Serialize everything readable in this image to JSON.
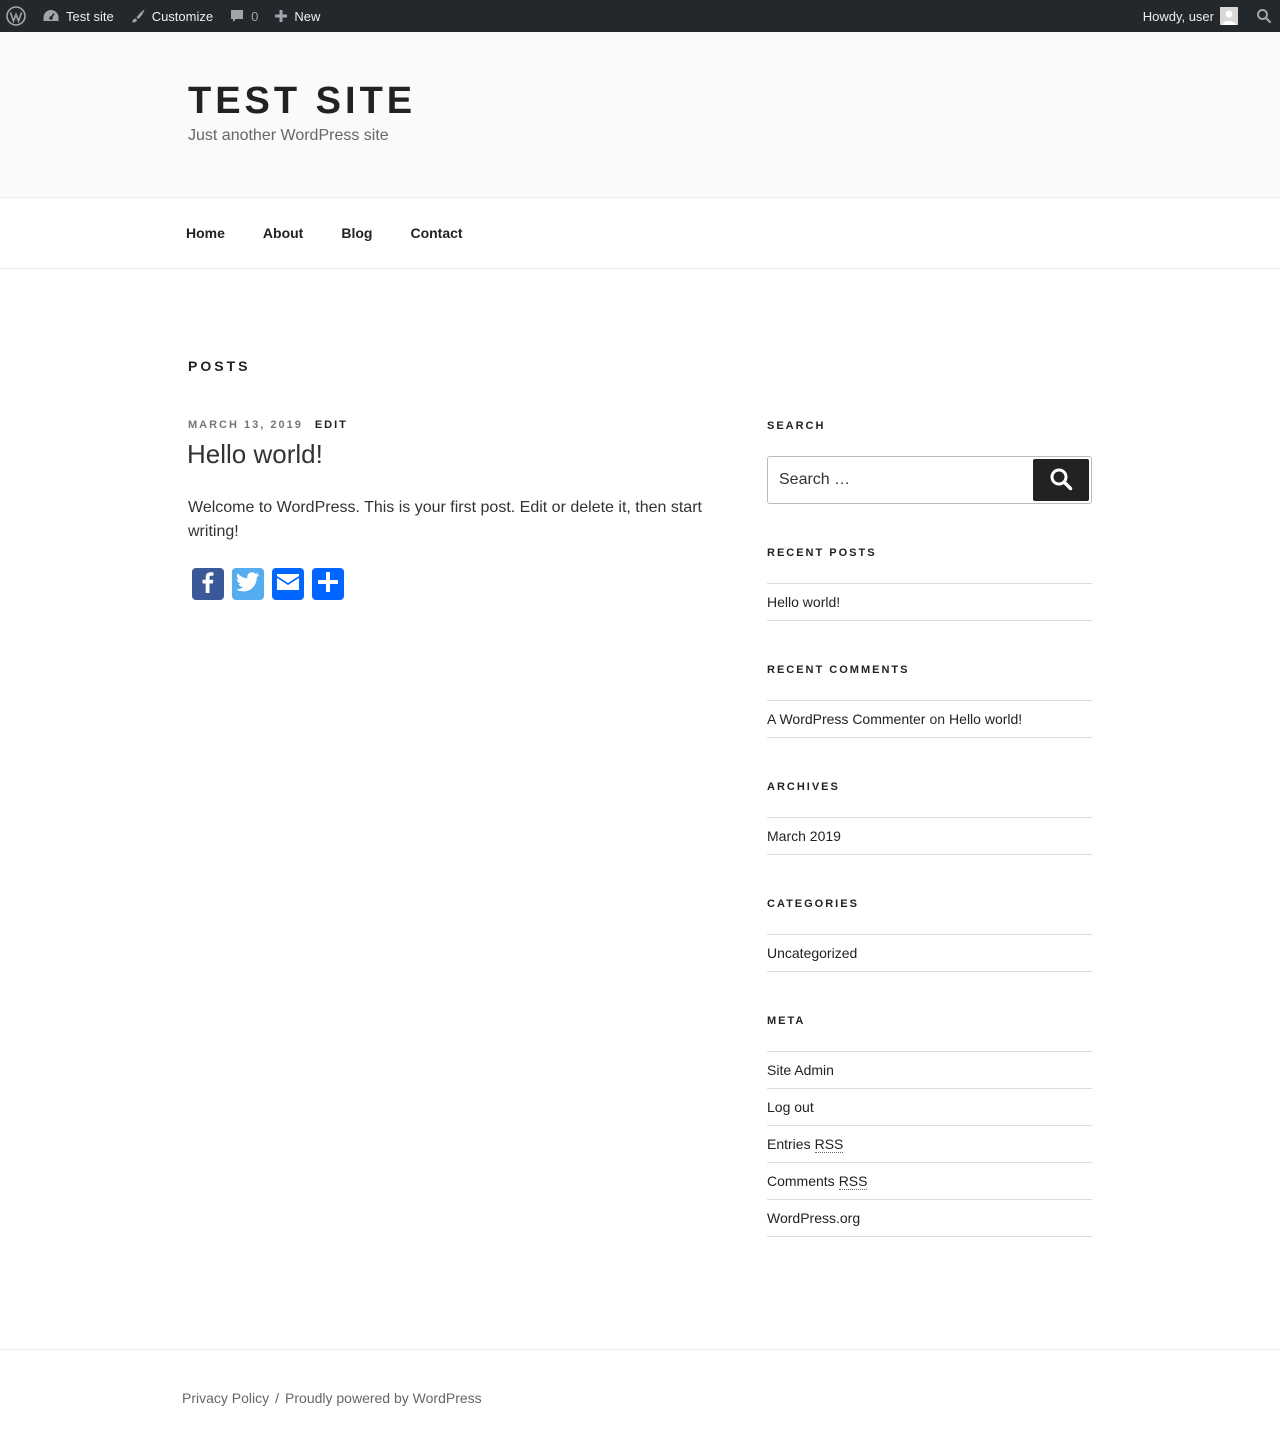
{
  "adminbar": {
    "site_name": "Test site",
    "customize": "Customize",
    "comments_count": "0",
    "new": "New",
    "howdy": "Howdy, user"
  },
  "header": {
    "site_title": "TEST SITE",
    "site_description": "Just another WordPress site"
  },
  "nav": {
    "items": [
      {
        "label": "Home"
      },
      {
        "label": "About"
      },
      {
        "label": "Blog"
      },
      {
        "label": "Contact"
      }
    ]
  },
  "page": {
    "title": "POSTS"
  },
  "post": {
    "date": "MARCH 13, 2019",
    "edit_label": "EDIT",
    "title": "Hello world!",
    "content": "Welcome to WordPress. This is your first post. Edit or delete it, then start writing!",
    "share": {
      "facebook_color": "#3b5998",
      "twitter_color": "#55acee",
      "email_color": "#0166ff",
      "share_color": "#0166ff"
    }
  },
  "sidebar": {
    "search": {
      "title": "SEARCH",
      "placeholder": "Search …"
    },
    "recent_posts": {
      "title": "RECENT POSTS",
      "items": [
        "Hello world!"
      ]
    },
    "recent_comments": {
      "title": "RECENT COMMENTS",
      "author": "A WordPress Commenter",
      "on": "on",
      "post": "Hello world!"
    },
    "archives": {
      "title": "ARCHIVES",
      "items": [
        "March 2019"
      ]
    },
    "categories": {
      "title": "CATEGORIES",
      "items": [
        "Uncategorized"
      ]
    },
    "meta": {
      "title": "META",
      "site_admin": "Site Admin",
      "log_out": "Log out",
      "entries": "Entries",
      "comments": "Comments",
      "rss": "RSS",
      "wordpress_org": "WordPress.org"
    }
  },
  "footer": {
    "privacy": "Privacy Policy",
    "separator": "/",
    "powered": "Proudly powered by WordPress"
  }
}
